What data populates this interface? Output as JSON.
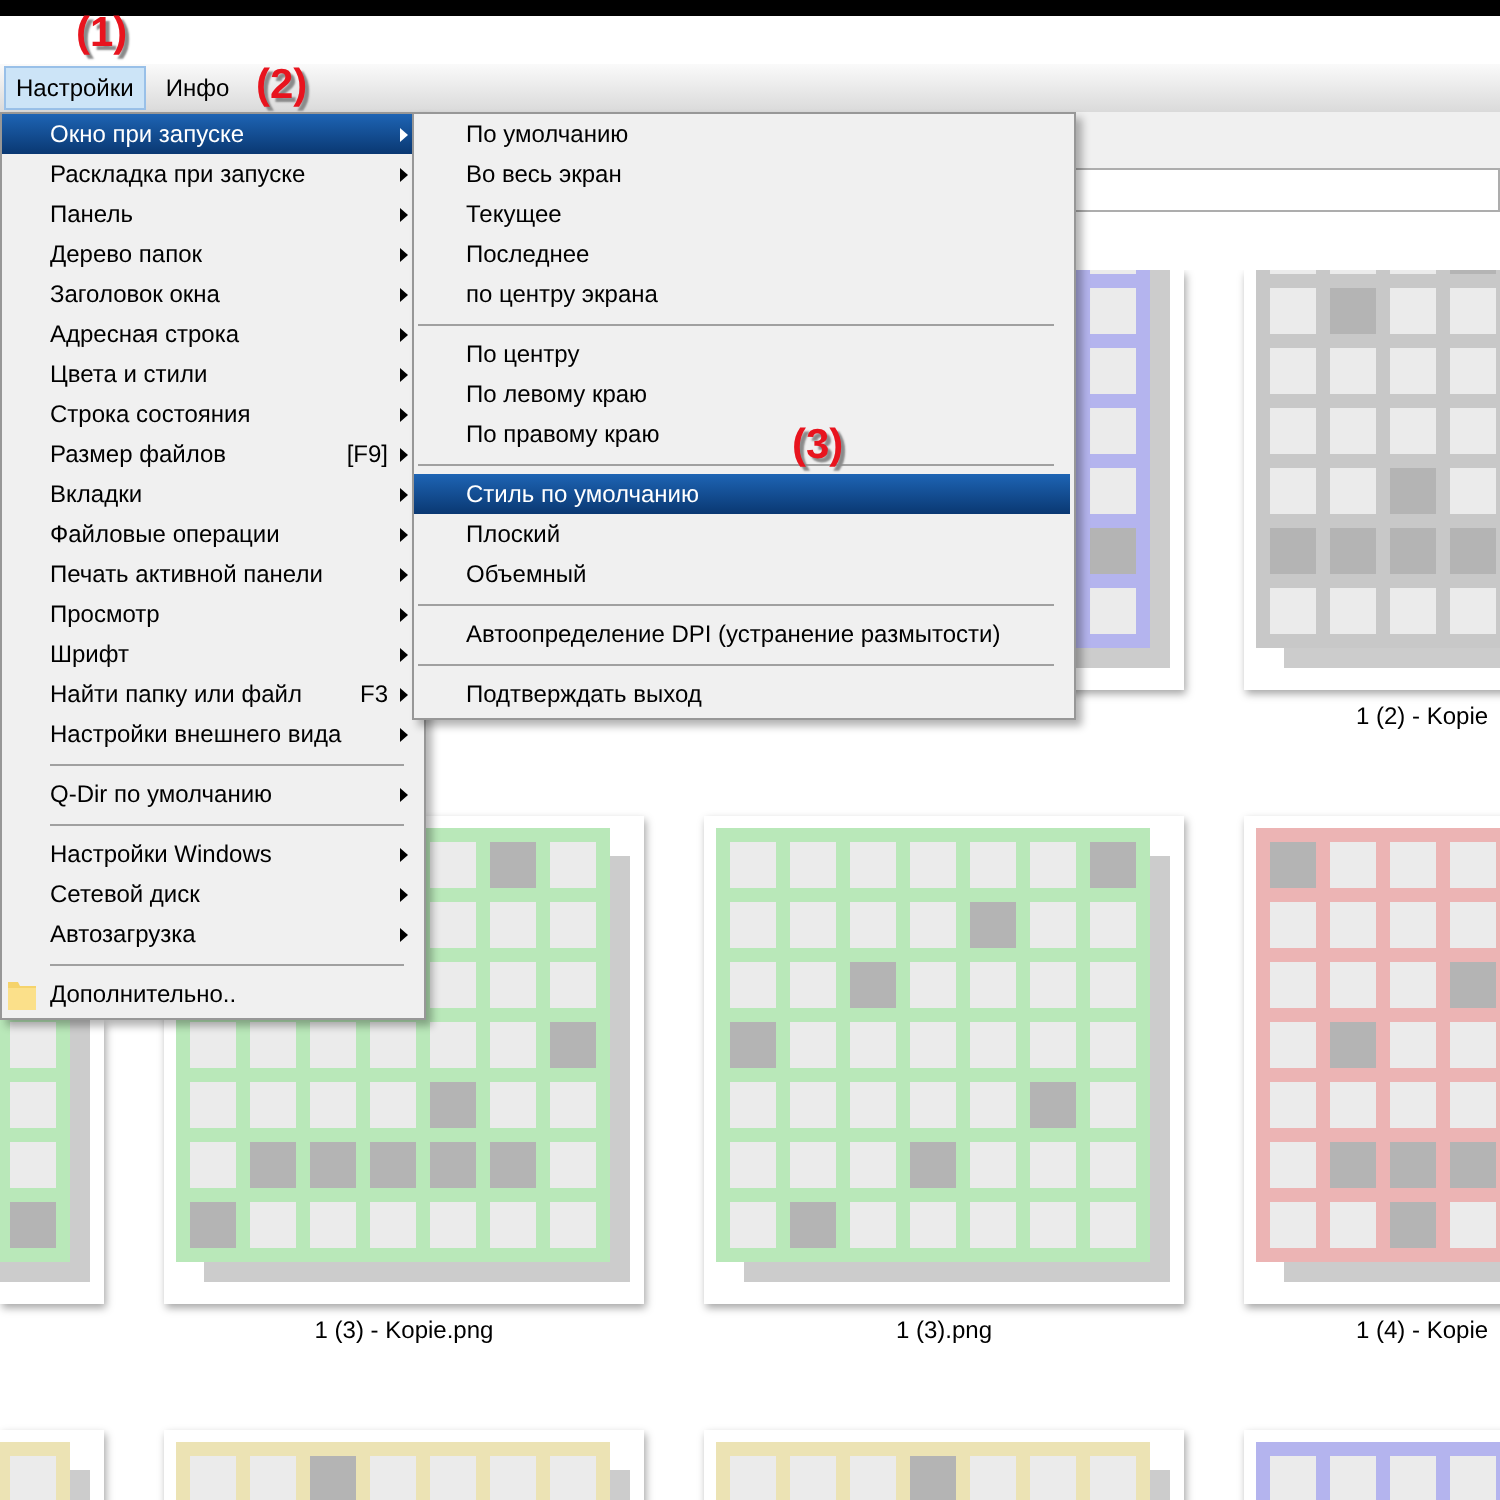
{
  "menubar": [
    {
      "label": "Настройки",
      "selected": true
    },
    {
      "label": "Инфо",
      "selected": false
    }
  ],
  "annotations": [
    {
      "text": "(1)"
    },
    {
      "text": "(2)"
    },
    {
      "text": "(3)"
    }
  ],
  "menu": {
    "items": [
      {
        "kind": "item",
        "label": "Окно при запуске",
        "submenu": true,
        "selected": true
      },
      {
        "kind": "item",
        "label": "Раскладка при запуске",
        "submenu": true,
        "selected": false
      },
      {
        "kind": "item",
        "label": "Панель",
        "submenu": true,
        "selected": false
      },
      {
        "kind": "item",
        "label": "Дерево папок",
        "submenu": true,
        "selected": false
      },
      {
        "kind": "item",
        "label": "Заголовок окна",
        "submenu": true,
        "selected": false
      },
      {
        "kind": "item",
        "label": "Адресная строка",
        "submenu": true,
        "selected": false
      },
      {
        "kind": "item",
        "label": "Цвета и стили",
        "submenu": true,
        "selected": false
      },
      {
        "kind": "item",
        "label": "Строка состояния",
        "submenu": true,
        "selected": false
      },
      {
        "kind": "item",
        "label": "Размер файлов",
        "shortcut": "[F9]",
        "submenu": true,
        "selected": false
      },
      {
        "kind": "item",
        "label": "Вкладки",
        "submenu": true,
        "selected": false
      },
      {
        "kind": "item",
        "label": "Файловые операции",
        "submenu": true,
        "selected": false
      },
      {
        "kind": "item",
        "label": "Печать активной панели",
        "submenu": true,
        "selected": false
      },
      {
        "kind": "item",
        "label": "Просмотр",
        "submenu": true,
        "selected": false
      },
      {
        "kind": "item",
        "label": "Шрифт",
        "submenu": true,
        "selected": false
      },
      {
        "kind": "item",
        "label": "Найти папку или файл",
        "shortcut": "F3",
        "submenu": true,
        "selected": false
      },
      {
        "kind": "item",
        "label": "Настройки внешнего вида",
        "submenu": true,
        "selected": false
      },
      {
        "kind": "separator"
      },
      {
        "kind": "item",
        "label": "Q-Dir по умолчанию",
        "submenu": true,
        "selected": false
      },
      {
        "kind": "separator"
      },
      {
        "kind": "item",
        "label": "Настройки Windows",
        "submenu": true,
        "selected": false
      },
      {
        "kind": "item",
        "label": "Сетевой диск",
        "submenu": true,
        "selected": false
      },
      {
        "kind": "item",
        "label": "Автозагрузка",
        "submenu": true,
        "selected": false
      },
      {
        "kind": "separator"
      },
      {
        "kind": "folder_item",
        "label": "Дополнительно..",
        "selected": false
      }
    ]
  },
  "submenu": {
    "items": [
      {
        "kind": "item",
        "label": "По умолчанию",
        "selected": false
      },
      {
        "kind": "item",
        "label": "Во весь экран",
        "selected": false
      },
      {
        "kind": "item",
        "label": "Текущее",
        "selected": false
      },
      {
        "kind": "item",
        "label": "Последнее",
        "selected": false
      },
      {
        "kind": "item",
        "label": "по центру экрана",
        "selected": false
      },
      {
        "kind": "separator"
      },
      {
        "kind": "item",
        "label": "По центру",
        "selected": false
      },
      {
        "kind": "item",
        "label": "По левому краю",
        "selected": false
      },
      {
        "kind": "item",
        "label": "По правому краю",
        "selected": false
      },
      {
        "kind": "separator"
      },
      {
        "kind": "item",
        "label": "Стиль по умолчанию",
        "selected": true
      },
      {
        "kind": "item",
        "label": "Плоский",
        "selected": false
      },
      {
        "kind": "item",
        "label": "Объемный",
        "selected": false
      },
      {
        "kind": "separator"
      },
      {
        "kind": "item",
        "label": "Автоопределение DPI (устранение размытости)",
        "selected": false
      },
      {
        "kind": "separator"
      },
      {
        "kind": "item",
        "label": "Подтверждать выход",
        "selected": false
      }
    ]
  },
  "thumbnails": [
    {
      "kind": "picture"
    },
    {
      "kind": "picture",
      "label": "1 (2) - Kopie"
    },
    {
      "kind": "picture"
    },
    {
      "kind": "picture",
      "label": "1 (3) - Kopie.png"
    },
    {
      "kind": "picture",
      "label": "1 (3).png"
    },
    {
      "kind": "picture",
      "label": "1 (4) - Kopie"
    },
    {
      "kind": "picture"
    },
    {
      "kind": "picture"
    },
    {
      "kind": "picture"
    },
    {
      "kind": "picture"
    }
  ]
}
